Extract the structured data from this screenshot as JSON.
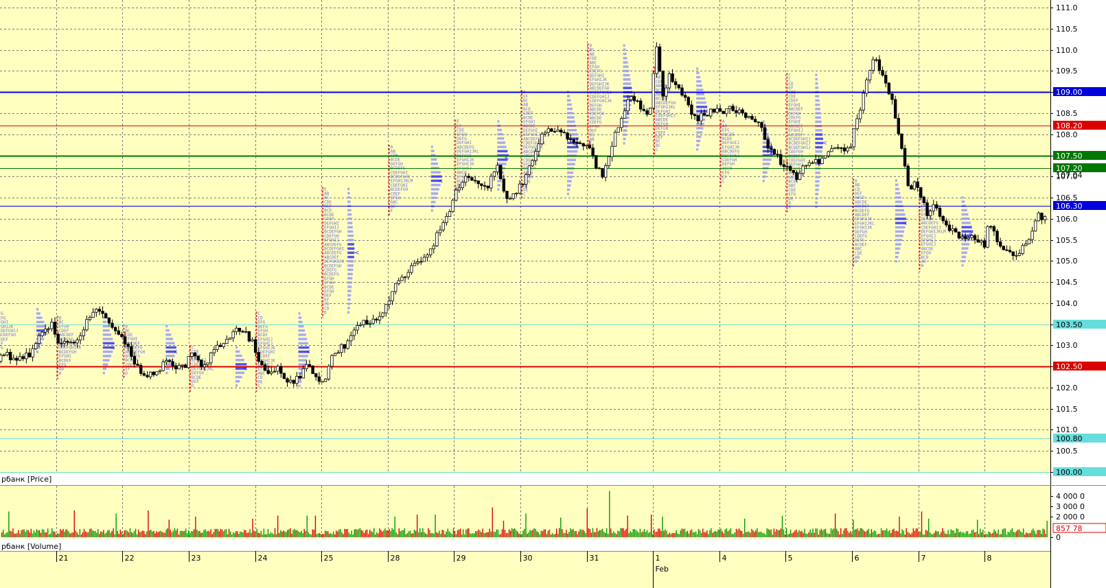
{
  "chart_data": {
    "type": "candlestick",
    "price_panel": {
      "title": "рбанк [Price]",
      "ylim": [
        100.0,
        111.1
      ],
      "tick_labels": [
        "111.0",
        "110.5",
        "110.0",
        "109.5",
        "109.0",
        "108.5",
        "108.0",
        "107.5",
        "107.0",
        "106.5",
        "106.0",
        "105.5",
        "105.0",
        "104.5",
        "104.0",
        "103.5",
        "103.0",
        "102.5",
        "102.0",
        "101.5",
        "101.0",
        "100.5",
        "100.0"
      ],
      "tick_values": [
        111.0,
        110.5,
        110.0,
        109.5,
        109.0,
        108.5,
        108.0,
        107.5,
        107.0,
        106.5,
        106.0,
        105.5,
        105.0,
        104.5,
        104.0,
        103.5,
        103.0,
        102.5,
        102.0,
        101.5,
        101.0,
        100.5,
        100.0
      ],
      "grid": true,
      "horizontal_levels": [
        {
          "label": "109.00",
          "value": 109.0,
          "color": "#0000dd",
          "text_color": "#ffffff",
          "weight": 2
        },
        {
          "label": "108.20",
          "value": 108.2,
          "color": "#dd0000",
          "text_color": "#ffffff",
          "weight": 1
        },
        {
          "label": "107.50",
          "value": 107.5,
          "color": "#007700",
          "text_color": "#ffffff",
          "weight": 2
        },
        {
          "label": "107.20",
          "value": 107.2,
          "color": "#007700",
          "text_color": "#ffffff",
          "weight": 1
        },
        {
          "label": "106.30",
          "value": 106.3,
          "color": "#0000dd",
          "text_color": "#ffffff",
          "weight": 1
        },
        {
          "label": "103.50",
          "value": 103.5,
          "color": "#66dddd",
          "text_color": "#000000",
          "weight": 1
        },
        {
          "label": "102.50",
          "value": 102.5,
          "color": "#dd0000",
          "text_color": "#ffffff",
          "weight": 2
        },
        {
          "label": "100.80",
          "value": 100.8,
          "color": "#66dddd",
          "text_color": "#000000",
          "weight": 1
        },
        {
          "label": "100.00",
          "value": 100.0,
          "color": "#66dddd",
          "text_color": "#000000",
          "weight": 1
        }
      ],
      "last_price": {
        "label": "107.04",
        "value": 107.04
      },
      "close_path": [
        [
          0,
          101.75
        ],
        [
          0.05,
          102.65
        ],
        [
          0.15,
          102.8
        ],
        [
          0.3,
          102.7
        ],
        [
          0.45,
          102.65
        ],
        [
          0.6,
          102.9
        ],
        [
          0.75,
          103.3
        ],
        [
          0.9,
          103.5
        ],
        [
          1.0,
          102.95
        ],
        [
          1.1,
          103.2
        ],
        [
          1.2,
          103.0
        ],
        [
          1.35,
          103.4
        ],
        [
          1.5,
          103.8
        ],
        [
          1.65,
          103.75
        ],
        [
          1.75,
          103.6
        ],
        [
          1.85,
          103.3
        ],
        [
          2.0,
          103.1
        ],
        [
          2.1,
          102.6
        ],
        [
          2.2,
          102.45
        ],
        [
          2.35,
          102.3
        ],
        [
          2.5,
          102.35
        ],
        [
          2.6,
          102.7
        ],
        [
          2.75,
          102.5
        ],
        [
          2.9,
          102.55
        ],
        [
          3.0,
          102.8
        ],
        [
          3.15,
          102.45
        ],
        [
          3.3,
          102.8
        ],
        [
          3.45,
          103.1
        ],
        [
          3.6,
          103.3
        ],
        [
          3.75,
          103.4
        ],
        [
          3.9,
          103.1
        ],
        [
          4.0,
          102.65
        ],
        [
          4.15,
          102.3
        ],
        [
          4.3,
          102.5
        ],
        [
          4.45,
          102.1
        ],
        [
          4.6,
          102.2
        ],
        [
          4.75,
          102.6
        ],
        [
          4.9,
          102.1
        ],
        [
          5.0,
          102.2
        ],
        [
          5.1,
          102.7
        ],
        [
          5.25,
          102.95
        ],
        [
          5.4,
          103.15
        ],
        [
          5.55,
          103.6
        ],
        [
          5.7,
          103.5
        ],
        [
          5.85,
          103.7
        ],
        [
          6.0,
          104.2
        ],
        [
          6.15,
          104.6
        ],
        [
          6.3,
          104.85
        ],
        [
          6.45,
          105.0
        ],
        [
          6.6,
          105.3
        ],
        [
          6.75,
          105.8
        ],
        [
          6.9,
          106.2
        ],
        [
          7.0,
          106.7
        ],
        [
          7.15,
          107.0
        ],
        [
          7.3,
          106.9
        ],
        [
          7.45,
          106.7
        ],
        [
          7.6,
          107.3
        ],
        [
          7.75,
          106.4
        ],
        [
          7.9,
          106.7
        ],
        [
          8.0,
          106.8
        ],
        [
          8.1,
          107.3
        ],
        [
          8.25,
          107.9
        ],
        [
          8.4,
          108.1
        ],
        [
          8.55,
          108.05
        ],
        [
          8.7,
          107.85
        ],
        [
          8.85,
          107.8
        ],
        [
          9.0,
          107.6
        ],
        [
          9.1,
          107.2
        ],
        [
          9.2,
          106.95
        ],
        [
          9.3,
          107.6
        ],
        [
          9.45,
          108.35
        ],
        [
          9.6,
          108.9
        ],
        [
          9.75,
          108.7
        ],
        [
          9.9,
          108.45
        ],
        [
          10.0,
          110.2
        ],
        [
          10.1,
          108.9
        ],
        [
          10.2,
          109.5
        ],
        [
          10.3,
          109.1
        ],
        [
          10.45,
          108.8
        ],
        [
          10.6,
          108.35
        ],
        [
          10.75,
          108.5
        ],
        [
          10.9,
          108.6
        ],
        [
          11.0,
          108.4
        ],
        [
          11.1,
          108.7
        ],
        [
          11.25,
          108.55
        ],
        [
          11.4,
          108.45
        ],
        [
          11.55,
          108.2
        ],
        [
          11.7,
          107.7
        ],
        [
          11.85,
          107.4
        ],
        [
          12.0,
          107.15
        ],
        [
          12.1,
          106.95
        ],
        [
          12.2,
          107.2
        ],
        [
          12.35,
          107.4
        ],
        [
          12.5,
          107.35
        ],
        [
          12.65,
          107.6
        ],
        [
          12.8,
          107.7
        ],
        [
          12.9,
          107.6
        ],
        [
          13.0,
          108.2
        ],
        [
          13.1,
          108.7
        ],
        [
          13.2,
          109.55
        ],
        [
          13.3,
          109.8
        ],
        [
          13.45,
          109.2
        ],
        [
          13.55,
          108.8
        ],
        [
          13.7,
          107.6
        ],
        [
          13.8,
          106.7
        ],
        [
          13.9,
          106.9
        ],
        [
          14.0,
          106.4
        ],
        [
          14.1,
          106.1
        ],
        [
          14.2,
          106.3
        ],
        [
          14.35,
          105.85
        ],
        [
          14.5,
          105.65
        ],
        [
          14.65,
          105.6
        ],
        [
          14.8,
          105.5
        ],
        [
          14.95,
          105.4
        ],
        [
          15.0,
          105.9
        ],
        [
          15.15,
          105.45
        ],
        [
          15.3,
          105.25
        ],
        [
          15.45,
          105.15
        ],
        [
          15.6,
          105.5
        ],
        [
          15.75,
          106.1
        ],
        [
          15.85,
          105.85
        ],
        [
          15.9,
          107.04
        ]
      ],
      "tpo_profiles": [
        {
          "day": 0.0,
          "mid": 103.3,
          "half": 0.6,
          "w": 55
        },
        {
          "day": 0.95,
          "mid": 102.95,
          "half": 0.75,
          "w": 60
        },
        {
          "day": 1.95,
          "mid": 102.85,
          "half": 0.65,
          "w": 55
        },
        {
          "day": 2.95,
          "mid": 102.45,
          "half": 0.55,
          "w": 60
        },
        {
          "day": 3.95,
          "mid": 102.85,
          "half": 0.95,
          "w": 55
        },
        {
          "day": 4.95,
          "mid": 105.2,
          "half": 1.55,
          "w": 30
        },
        {
          "day": 5.95,
          "mid": 106.9,
          "half": 0.85,
          "w": 55
        },
        {
          "day": 6.95,
          "mid": 107.45,
          "half": 0.9,
          "w": 55
        },
        {
          "day": 7.95,
          "mid": 107.75,
          "half": 1.3,
          "w": 60
        },
        {
          "day": 8.95,
          "mid": 108.9,
          "half": 1.25,
          "w": 45
        },
        {
          "day": 9.95,
          "mid": 108.55,
          "half": 1.05,
          "w": 55
        },
        {
          "day": 10.95,
          "mid": 107.55,
          "half": 0.8,
          "w": 55
        },
        {
          "day": 11.95,
          "mid": 107.8,
          "half": 1.65,
          "w": 35
        },
        {
          "day": 12.95,
          "mid": 105.9,
          "half": 1.05,
          "w": 55
        },
        {
          "day": 13.95,
          "mid": 105.65,
          "half": 0.9,
          "w": 55
        }
      ]
    },
    "volume_panel": {
      "title": "рбанк [Volume]",
      "tick_labels": [
        "4 000 0",
        "3 000 0",
        "2 000 0",
        "0"
      ],
      "tick_values": [
        4000,
        3000,
        2000,
        0
      ],
      "ylim": [
        0,
        4600
      ],
      "last_label": "857 78",
      "last_value": 857.78,
      "spikes": [
        {
          "i": 5,
          "v": 2500
        },
        {
          "i": 52,
          "v": 2600
        },
        {
          "i": 82,
          "v": 2300
        },
        {
          "i": 105,
          "v": 2600
        },
        {
          "i": 120,
          "v": 1700
        },
        {
          "i": 139,
          "v": 2000
        },
        {
          "i": 180,
          "v": 1800
        },
        {
          "i": 198,
          "v": 2100
        },
        {
          "i": 219,
          "v": 2100
        },
        {
          "i": 225,
          "v": 2100
        },
        {
          "i": 282,
          "v": 2000
        },
        {
          "i": 298,
          "v": 2200
        },
        {
          "i": 311,
          "v": 2200
        },
        {
          "i": 352,
          "v": 2900
        },
        {
          "i": 360,
          "v": 1600
        },
        {
          "i": 376,
          "v": 2300
        },
        {
          "i": 401,
          "v": 1900
        },
        {
          "i": 420,
          "v": 2800
        },
        {
          "i": 436,
          "v": 4500
        },
        {
          "i": 449,
          "v": 2100
        },
        {
          "i": 466,
          "v": 2200
        },
        {
          "i": 474,
          "v": 2000
        },
        {
          "i": 533,
          "v": 1800
        },
        {
          "i": 560,
          "v": 2100
        },
        {
          "i": 598,
          "v": 2300
        },
        {
          "i": 611,
          "v": 1700
        },
        {
          "i": 644,
          "v": 2000
        },
        {
          "i": 660,
          "v": 2500
        },
        {
          "i": 665,
          "v": 1800
        },
        {
          "i": 700,
          "v": 1700
        },
        {
          "i": 750,
          "v": 1600
        }
      ]
    },
    "x_axis": {
      "day_labels": [
        "8",
        "21",
        "22",
        "23",
        "24",
        "25",
        "28",
        "29",
        "30",
        "31",
        "1",
        "4",
        "5",
        "6",
        "7",
        "8"
      ],
      "day_positions": [
        0,
        0.95,
        1.95,
        2.95,
        3.95,
        4.95,
        5.95,
        6.95,
        7.95,
        8.95,
        9.95,
        10.95,
        11.95,
        12.95,
        13.95,
        14.95
      ],
      "month_label": "Feb",
      "month_position": 9.95
    }
  },
  "colors": {
    "panel_bg": "#ffffc0",
    "grid": "#7a7a7a",
    "bull": "#009900",
    "bear": "#dd0000",
    "candle": "#000000",
    "tpo_text": "#7070e0",
    "tpo_bar": "#3333ff",
    "tpo_bar_light": "#9999ff",
    "tpo_poc": "#ee3333"
  }
}
